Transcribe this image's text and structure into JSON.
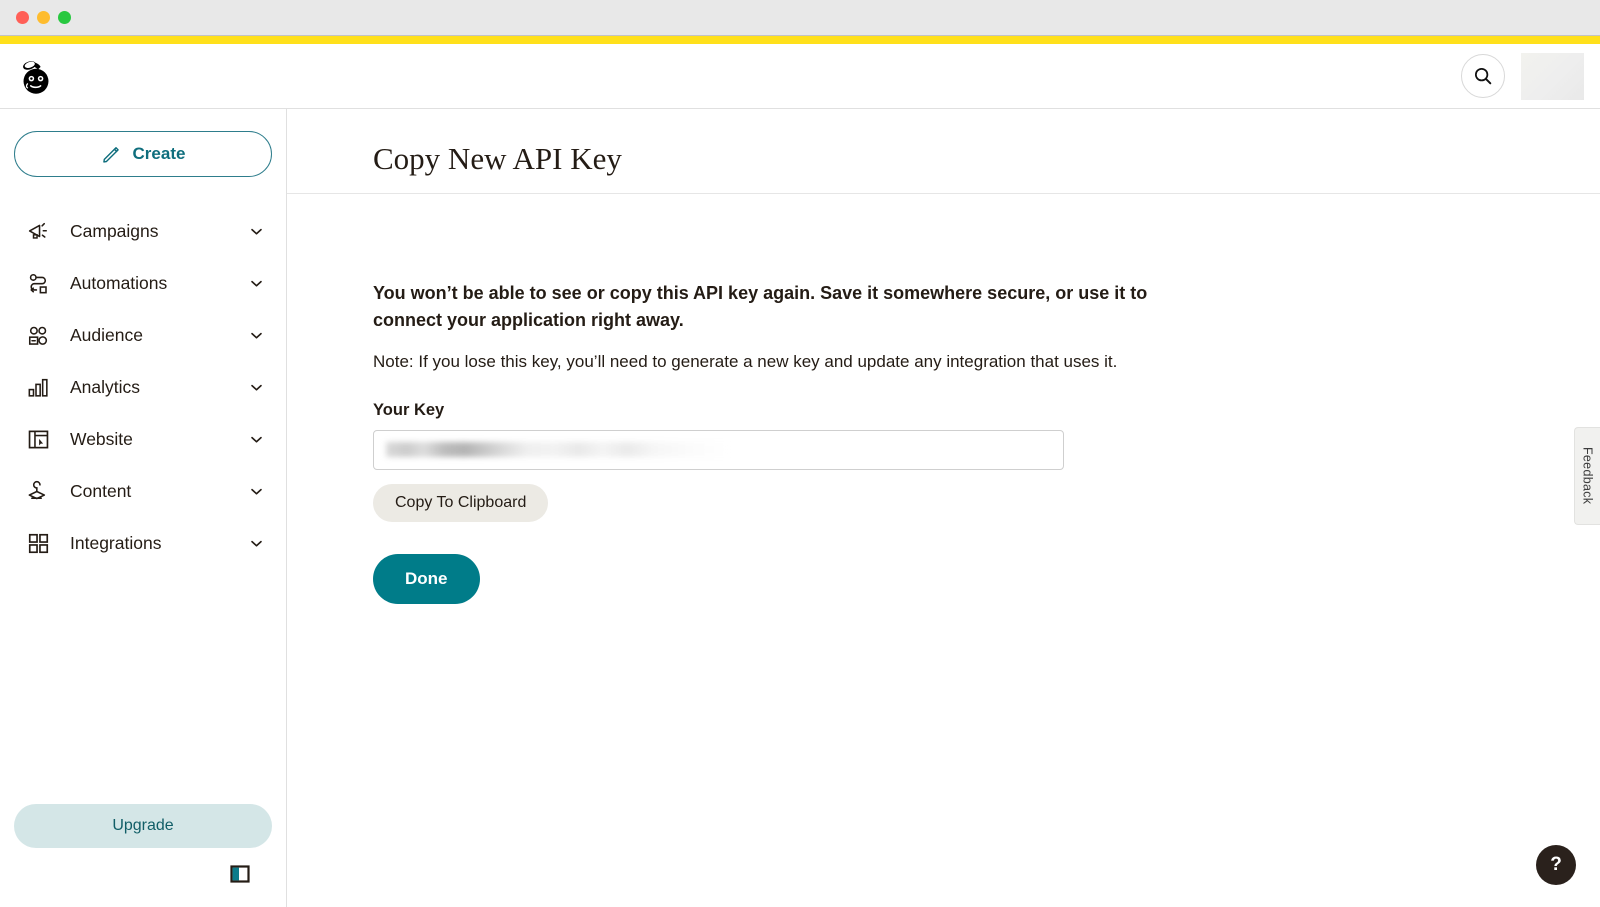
{
  "window": {
    "traffic_lights": [
      "close",
      "minimize",
      "maximize"
    ],
    "brand_bar_color": "#ffe01b"
  },
  "header": {
    "logo_name": "mailchimp-logo",
    "search_icon": "search-icon",
    "avatar_label": ""
  },
  "sidebar": {
    "create_label": "Create",
    "items": [
      {
        "label": "Campaigns",
        "icon": "megaphone-icon"
      },
      {
        "label": "Automations",
        "icon": "automation-flow-icon"
      },
      {
        "label": "Audience",
        "icon": "people-icon"
      },
      {
        "label": "Analytics",
        "icon": "bar-chart-icon"
      },
      {
        "label": "Website",
        "icon": "browser-window-icon"
      },
      {
        "label": "Content",
        "icon": "content-stack-icon"
      },
      {
        "label": "Integrations",
        "icon": "grid-squares-icon"
      }
    ],
    "upgrade_label": "Upgrade",
    "collapse_icon": "collapse-sidebar-icon"
  },
  "main": {
    "title": "Copy New API Key",
    "lede": "You won’t be able to see or copy this API key again. Save it somewhere secure, or use it to connect your application right away.",
    "note": "Note: If you lose this key, you’ll need to generate a new key and update any integration that uses it.",
    "key_field_label": "Your Key",
    "key_value": "",
    "copy_button_label": "Copy To Clipboard",
    "done_button_label": "Done"
  },
  "feedback": {
    "label": "Feedback"
  },
  "help": {
    "label": "?"
  },
  "colors": {
    "brand_yellow": "#ffe01b",
    "teal": "#007c89",
    "teal_light": "#d4e6e7",
    "text": "#241c15"
  }
}
